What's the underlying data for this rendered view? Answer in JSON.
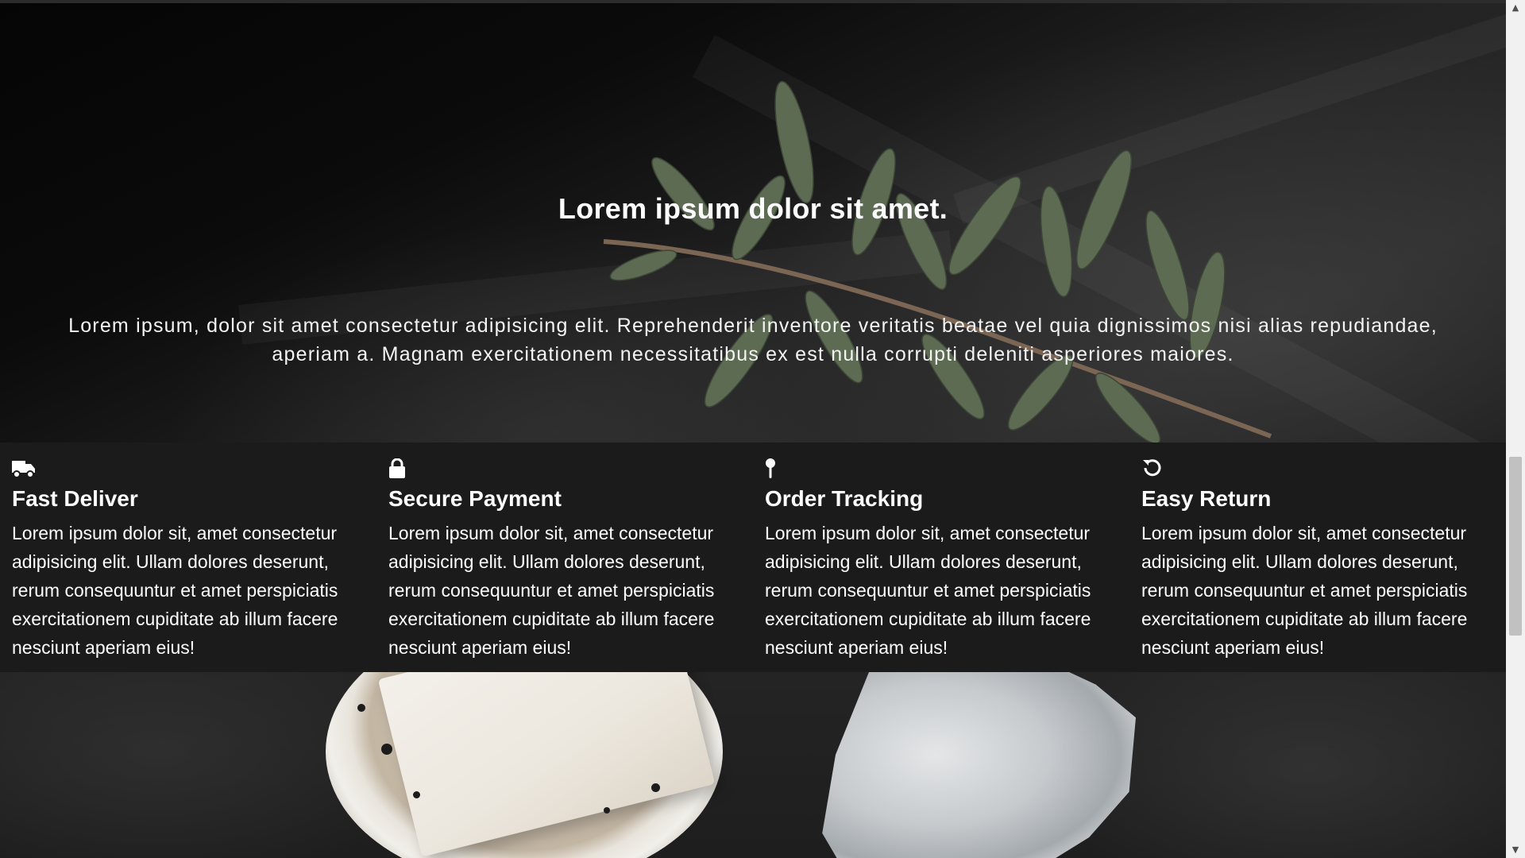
{
  "hero": {
    "title": "Lorem ipsum dolor sit amet.",
    "text": "Lorem ipsum, dolor sit amet consectetur adipisicing elit. Reprehenderit inventore veritatis beatae vel quia dignissimos nisi alias repudiandae, aperiam a. Magnam exercitationem necessitatibus ex est nulla corrupti deleniti asperiores maiores."
  },
  "features": [
    {
      "icon": "truck-icon",
      "title": "Fast Deliver",
      "text": "Lorem ipsum dolor sit, amet consectetur adipisicing elit. Ullam dolores deserunt, rerum consequuntur et amet perspiciatis exercitationem cupiditate ab illum facere nesciunt aperiam eius!"
    },
    {
      "icon": "lock-icon",
      "title": "Secure Payment",
      "text": "Lorem ipsum dolor sit, amet consectetur adipisicing elit. Ullam dolores deserunt, rerum consequuntur et amet perspiciatis exercitationem cupiditate ab illum facere nesciunt aperiam eius!"
    },
    {
      "icon": "map-pin-icon",
      "title": "Order Tracking",
      "text": "Lorem ipsum dolor sit, amet consectetur adipisicing elit. Ullam dolores deserunt, rerum consequuntur et amet perspiciatis exercitationem cupiditate ab illum facere nesciunt aperiam eius!"
    },
    {
      "icon": "undo-icon",
      "title": "Easy Return",
      "text": "Lorem ipsum dolor sit, amet consectetur adipisicing elit. Ullam dolores deserunt, rerum consequuntur et amet perspiciatis exercitationem cupiditate ab illum facere nesciunt aperiam eius!"
    }
  ],
  "scrollbar": {
    "up_arrow": "▲",
    "down_arrow": "▼"
  },
  "colors": {
    "feature_band": "#1b1b1b",
    "text": "#ffffff",
    "scrollbar_track": "#f1f1f1",
    "scrollbar_thumb": "#c1c1c1"
  }
}
